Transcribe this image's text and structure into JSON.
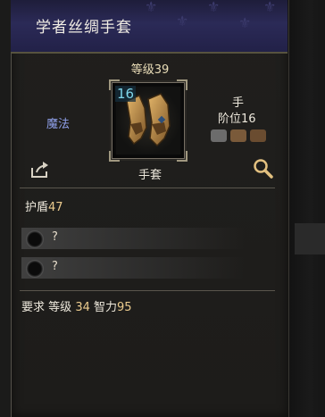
{
  "tooltip": {
    "title": "学者丝绸手套",
    "level_text": "等级39",
    "left_label": "魔法",
    "item_level": "16",
    "type_label": "手套",
    "slot_label": "手",
    "tier_label": "阶位16",
    "armor": {
      "label": "护盾",
      "value": "47"
    },
    "sockets": [
      {
        "label": "?"
      },
      {
        "label": "?"
      }
    ],
    "requirements": {
      "prefix": "要求",
      "level_label": "等级",
      "level_value": "34",
      "int_label": "智力",
      "int_value": "95"
    },
    "icons": {
      "share": "share-icon",
      "inspect": "magnifier-icon",
      "item": "silk-gloves-icon",
      "requirement_badges": [
        "grey-badge-icon",
        "brown-badge-icon",
        "brown-badge-icon"
      ]
    },
    "colors": {
      "header_bg": "#2b2a57",
      "magic_label": "#8fa0ea",
      "item_level": "#7fd6ea",
      "value_accent": "#eccc8e"
    }
  }
}
